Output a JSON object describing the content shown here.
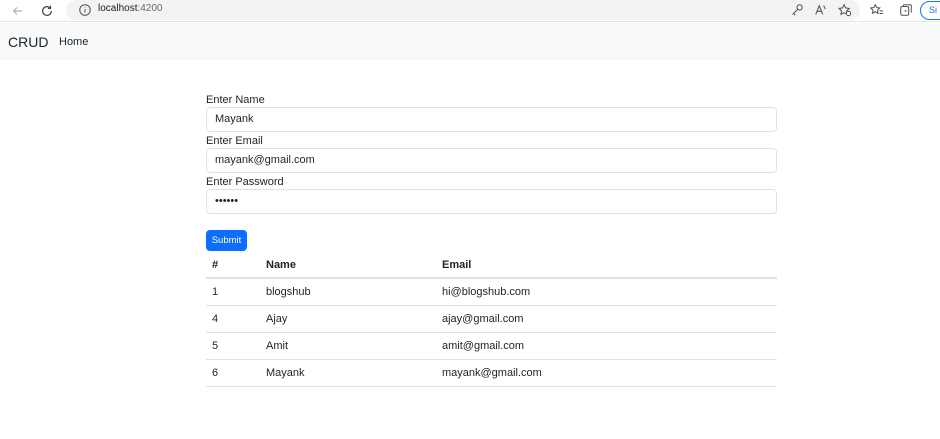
{
  "browser": {
    "url_host": "localhost",
    "url_port": ":4200",
    "signin_label": "Si"
  },
  "navbar": {
    "brand": "CRUD",
    "home_label": "Home"
  },
  "form": {
    "name_label": "Enter Name",
    "name_value": "Mayank",
    "email_label": "Enter Email",
    "email_value": "mayank@gmail.com",
    "password_label": "Enter Password",
    "password_value": "••••••",
    "submit_label": "Submit"
  },
  "table": {
    "headers": [
      "#",
      "Name",
      "Email"
    ],
    "rows": [
      [
        "1",
        "blogshub",
        "hi@blogshub.com"
      ],
      [
        "4",
        "Ajay",
        "ajay@gmail.com"
      ],
      [
        "5",
        "Amit",
        "amit@gmail.com"
      ],
      [
        "6",
        "Mayank",
        "mayank@gmail.com"
      ]
    ]
  },
  "colors": {
    "primary": "#0d6efd",
    "navbar_bg": "#f8f9fa",
    "border": "#dee2e6"
  }
}
